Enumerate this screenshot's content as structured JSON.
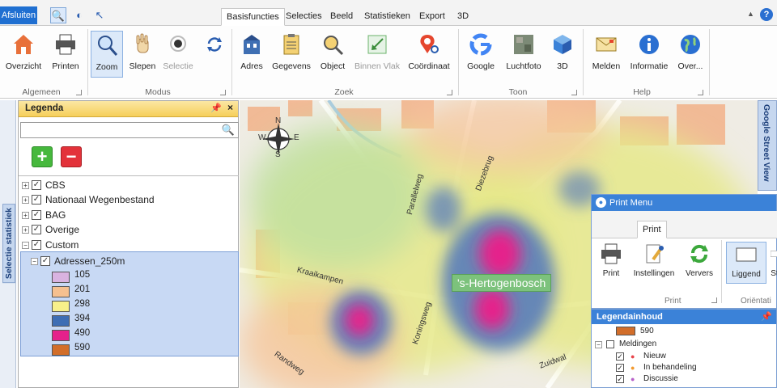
{
  "topbar": {
    "exit_label": "Afsluiten",
    "tabs": [
      "Basisfuncties",
      "Selecties",
      "Beeld",
      "Statistieken",
      "Export",
      "3D"
    ],
    "active_tab": "Basisfuncties",
    "help_label": "?"
  },
  "ribbon": {
    "groups": [
      {
        "label": "Algemeen",
        "buttons": [
          "Overzicht",
          "Printen"
        ]
      },
      {
        "label": "Modus",
        "buttons": [
          "Zoom",
          "Slepen",
          "Selectie"
        ]
      },
      {
        "label": "Zoek",
        "buttons": [
          "Adres",
          "Gegevens",
          "Object",
          "Binnen Vlak",
          "Coördinaat"
        ]
      },
      {
        "label": "Toon",
        "buttons": [
          "Google",
          "Luchtfoto",
          "3D"
        ]
      },
      {
        "label": "Help",
        "buttons": [
          "Melden",
          "Informatie",
          "Over..."
        ]
      }
    ]
  },
  "left_tab": "Selectie statistiek",
  "right_tab": "Google Street View",
  "legend": {
    "title": "Legenda",
    "add_symbol": "+",
    "remove_symbol": "−",
    "layers": [
      "CBS",
      "Nationaal Wegenbestand",
      "BAG",
      "Overige",
      "Custom"
    ],
    "sublayer": "Adressen_250m",
    "classes": [
      {
        "label": "105",
        "color": "#d9b3e0"
      },
      {
        "label": "201",
        "color": "#f5c08f"
      },
      {
        "label": "298",
        "color": "#f8f08a"
      },
      {
        "label": "394",
        "color": "#3e6eb4"
      },
      {
        "label": "490",
        "color": "#e5218b"
      },
      {
        "label": "590",
        "color": "#d26e2a"
      }
    ]
  },
  "map": {
    "city_label": "'s-Hertogenbosch",
    "streets": [
      "Parallelweg",
      "Diezebrug",
      "Kraaikampen",
      "Koningsweg",
      "Zuidwal",
      "Randweg"
    ],
    "compass": [
      "N",
      "E",
      "S",
      "W"
    ]
  },
  "print_menu": {
    "title": "Print Menu",
    "tab": "Print",
    "buttons": [
      "Print",
      "Instellingen",
      "Ververs",
      "Liggend",
      "St"
    ],
    "groups": [
      "Print",
      "Oriëntati"
    ]
  },
  "legend_content": {
    "title": "Legendainhoud",
    "top_value": "590",
    "group": "Meldingen",
    "items": [
      {
        "label": "Nieuw",
        "color": "#e8434a"
      },
      {
        "label": "In behandeling",
        "color": "#f29a2e"
      },
      {
        "label": "Discussie",
        "color": "#b860c9"
      }
    ]
  }
}
